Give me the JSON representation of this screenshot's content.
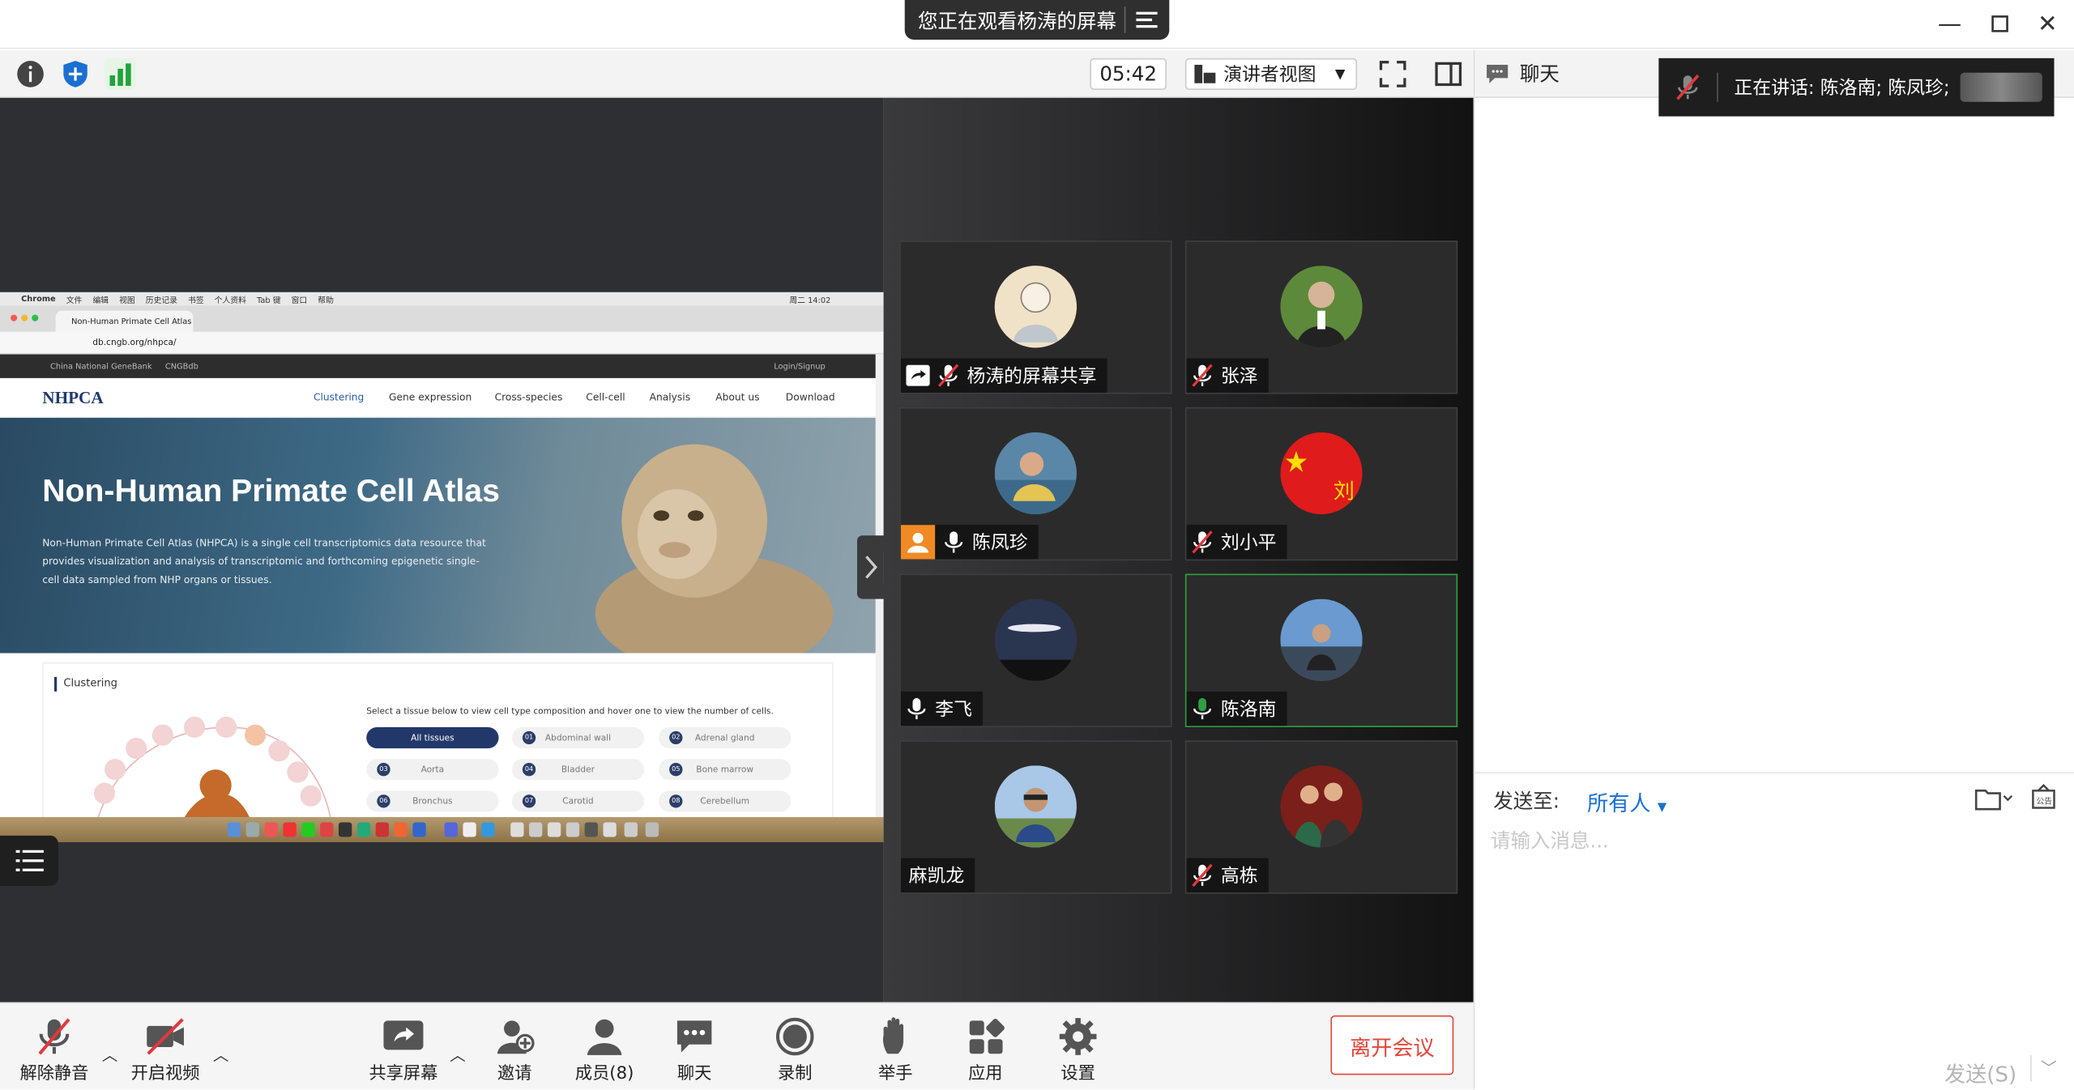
{
  "window": {
    "share_banner": "您正在观看杨涛的屏幕"
  },
  "toolbar": {
    "timer": "05:42",
    "view_label": "演讲者视图"
  },
  "participants": [
    {
      "name": "杨涛的屏幕共享",
      "mic": "muted",
      "share": true
    },
    {
      "name": "张泽",
      "mic": "muted"
    },
    {
      "name": "陈凤珍",
      "mic": "on",
      "avatar_badge": true
    },
    {
      "name": "刘小平",
      "mic": "muted"
    },
    {
      "name": "李飞",
      "mic": "on"
    },
    {
      "name": "陈洛南",
      "mic": "speaking",
      "active": true
    },
    {
      "name": "麻凯龙",
      "mic": "none"
    },
    {
      "name": "高栋",
      "mic": "muted"
    }
  ],
  "shared_screen": {
    "mac_menu": [
      "Chrome",
      "文件",
      "编辑",
      "视图",
      "历史记录",
      "书签",
      "个人资料",
      "Tab 键",
      "窗口",
      "帮助"
    ],
    "clock": "周二 14:02",
    "tab_title": "Non-Human Primate Cell Atlas",
    "url": "db.cngb.org/nhpca/",
    "gb_links": [
      "China National GeneBank",
      "CNGBdb"
    ],
    "login": "Login/Signup",
    "logo": "NHPCA",
    "nav": [
      "Clustering",
      "Gene expression",
      "Cross-species",
      "Cell-cell",
      "Analysis",
      "About us",
      "Download"
    ],
    "hero_title": "Non-Human Primate Cell Atlas",
    "hero_desc": "Non-Human Primate Cell Atlas (NHPCA) is a single cell transcriptomics data resource that provides visualization and analysis of transcriptomic and forthcoming epigenetic single-cell data sampled from NHP organs or tissues.",
    "section_title": "Clustering",
    "instruction": "Select a tissue below to view cell type composition and hover one to view the number of cells.",
    "tissues": [
      {
        "num": "",
        "label": "All tissues"
      },
      {
        "num": "01",
        "label": "Abdominal wall"
      },
      {
        "num": "02",
        "label": "Adrenal gland"
      },
      {
        "num": "03",
        "label": "Aorta"
      },
      {
        "num": "04",
        "label": "Bladder"
      },
      {
        "num": "05",
        "label": "Bone marrow"
      },
      {
        "num": "06",
        "label": "Bronchus"
      },
      {
        "num": "07",
        "label": "Carotid"
      },
      {
        "num": "08",
        "label": "Cerebellum"
      }
    ]
  },
  "bottom": {
    "unmute": "解除静音",
    "start_video": "开启视频",
    "share_screen": "共享屏幕",
    "invite": "邀请",
    "members": "成员(8)",
    "chat": "聊天",
    "record": "录制",
    "raise_hand": "举手",
    "apps": "应用",
    "settings": "设置",
    "leave": "离开会议"
  },
  "chat": {
    "title": "聊天",
    "speaking": "正在讲话: 陈洛南; 陈凤珍;",
    "send_to_label": "发送至:",
    "send_to_value": "所有人",
    "placeholder": "请输入消息...",
    "send_button": "发送(S)"
  },
  "colors": {
    "accent": "#1a6fd1",
    "leave": "#e2463a",
    "speaking": "#2ea043",
    "muted": "#e0393e"
  }
}
